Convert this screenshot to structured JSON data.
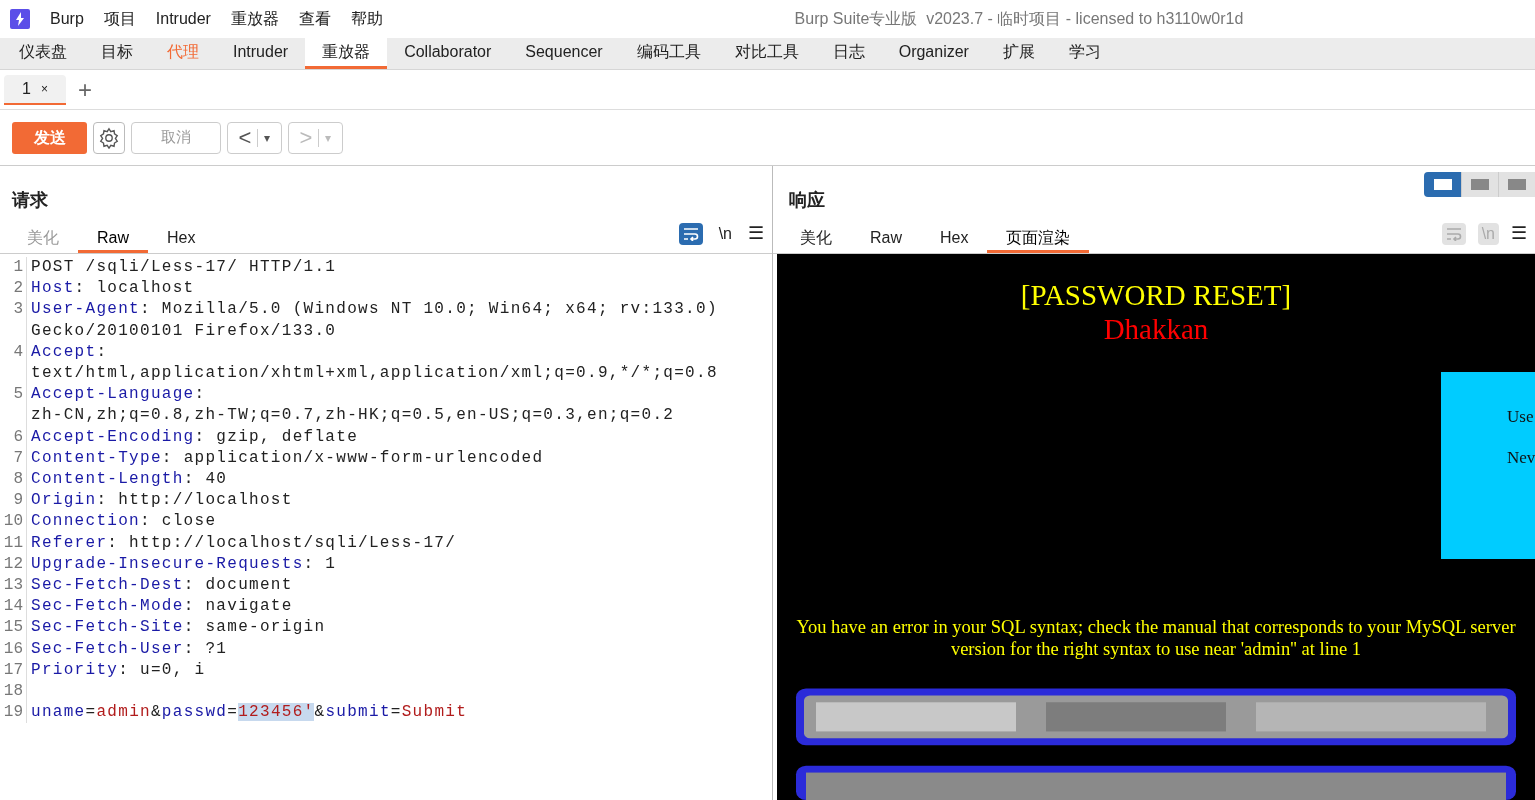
{
  "menu_bar": {
    "items": [
      "Burp",
      "项目",
      "Intruder",
      "重放器",
      "查看",
      "帮助"
    ],
    "title": "Burp Suite专业版  v2023.7 - 临时项目 - licensed to h3110w0r1d"
  },
  "main_tabs": [
    {
      "label": "仪表盘",
      "selected": false,
      "highlighted": false
    },
    {
      "label": "目标",
      "selected": false,
      "highlighted": false
    },
    {
      "label": "代理",
      "selected": false,
      "highlighted": true
    },
    {
      "label": "Intruder",
      "selected": false,
      "highlighted": false
    },
    {
      "label": "重放器",
      "selected": true,
      "highlighted": false
    },
    {
      "label": "Collaborator",
      "selected": false,
      "highlighted": false
    },
    {
      "label": "Sequencer",
      "selected": false,
      "highlighted": false
    },
    {
      "label": "编码工具",
      "selected": false,
      "highlighted": false
    },
    {
      "label": "对比工具",
      "selected": false,
      "highlighted": false
    },
    {
      "label": "日志",
      "selected": false,
      "highlighted": false
    },
    {
      "label": "Organizer",
      "selected": false,
      "highlighted": false
    },
    {
      "label": "扩展",
      "selected": false,
      "highlighted": false
    },
    {
      "label": "学习",
      "selected": false,
      "highlighted": false
    }
  ],
  "repeater_tabs": [
    {
      "label": "1",
      "close": "×",
      "selected": true
    }
  ],
  "new_tab": "+",
  "toolbar": {
    "send": "发送",
    "cancel": {
      "label": "取消",
      "disabled": true
    },
    "back": {
      "label": "<",
      "caret": "▾",
      "disabled": false
    },
    "forward": {
      "label": ">",
      "caret": "▾",
      "disabled": true
    }
  },
  "layout_toggle": [
    {
      "selected": true
    },
    {
      "selected": false
    },
    {
      "selected": false
    }
  ],
  "request": {
    "title": "请求",
    "tabs": [
      {
        "label": "美化",
        "selected": false,
        "disabled": true
      },
      {
        "label": "Raw",
        "selected": true,
        "disabled": false
      },
      {
        "label": "Hex",
        "selected": false,
        "disabled": false
      }
    ],
    "wrap_on": true,
    "newline_label": "\\n",
    "menu_icon": "☰",
    "lines": [
      {
        "number": "1",
        "rows": [
          [
            {
              "kind": "plain",
              "text": "POST /sqli/Less-17/ HTTP/1.1"
            }
          ]
        ]
      },
      {
        "number": "2",
        "rows": [
          [
            {
              "kind": "key",
              "text": "Host"
            },
            {
              "kind": "plain",
              "text": ": localhost"
            }
          ]
        ]
      },
      {
        "number": "3",
        "rows": [
          [
            {
              "kind": "key",
              "text": "User-Agent"
            },
            {
              "kind": "plain",
              "text": ": Mozilla/5.0 (Windows NT 10.0; Win64; x64; rv:133.0)"
            }
          ],
          [
            {
              "kind": "plain",
              "text": "Gecko/20100101 Firefox/133.0"
            }
          ]
        ]
      },
      {
        "number": "4",
        "rows": [
          [
            {
              "kind": "key",
              "text": "Accept"
            },
            {
              "kind": "plain",
              "text": ":"
            }
          ],
          [
            {
              "kind": "plain",
              "text": "text/html,application/xhtml+xml,application/xml;q=0.9,*/*;q=0.8"
            }
          ]
        ]
      },
      {
        "number": "5",
        "rows": [
          [
            {
              "kind": "key",
              "text": "Accept-Language"
            },
            {
              "kind": "plain",
              "text": ":"
            }
          ],
          [
            {
              "kind": "plain",
              "text": "zh-CN,zh;q=0.8,zh-TW;q=0.7,zh-HK;q=0.5,en-US;q=0.3,en;q=0.2"
            }
          ]
        ]
      },
      {
        "number": "6",
        "rows": [
          [
            {
              "kind": "key",
              "text": "Accept-Encoding"
            },
            {
              "kind": "plain",
              "text": ": gzip, deflate"
            }
          ]
        ]
      },
      {
        "number": "7",
        "rows": [
          [
            {
              "kind": "key",
              "text": "Content-Type"
            },
            {
              "kind": "plain",
              "text": ": application/x-www-form-urlencoded"
            }
          ]
        ]
      },
      {
        "number": "8",
        "rows": [
          [
            {
              "kind": "key",
              "text": "Content-Length"
            },
            {
              "kind": "plain",
              "text": ": 40"
            }
          ]
        ]
      },
      {
        "number": "9",
        "rows": [
          [
            {
              "kind": "key",
              "text": "Origin"
            },
            {
              "kind": "plain",
              "text": ": http://localhost"
            }
          ]
        ]
      },
      {
        "number": "10",
        "rows": [
          [
            {
              "kind": "key",
              "text": "Connection"
            },
            {
              "kind": "plain",
              "text": ": close"
            }
          ]
        ]
      },
      {
        "number": "11",
        "rows": [
          [
            {
              "kind": "key",
              "text": "Referer"
            },
            {
              "kind": "plain",
              "text": ": http://localhost/sqli/Less-17/"
            }
          ]
        ]
      },
      {
        "number": "12",
        "rows": [
          [
            {
              "kind": "key",
              "text": "Upgrade-Insecure-Requests"
            },
            {
              "kind": "plain",
              "text": ": 1"
            }
          ]
        ]
      },
      {
        "number": "13",
        "rows": [
          [
            {
              "kind": "key",
              "text": "Sec-Fetch-Dest"
            },
            {
              "kind": "plain",
              "text": ": document"
            }
          ]
        ]
      },
      {
        "number": "14",
        "rows": [
          [
            {
              "kind": "key",
              "text": "Sec-Fetch-Mode"
            },
            {
              "kind": "plain",
              "text": ": navigate"
            }
          ]
        ]
      },
      {
        "number": "15",
        "rows": [
          [
            {
              "kind": "key",
              "text": "Sec-Fetch-Site"
            },
            {
              "kind": "plain",
              "text": ": same-origin"
            }
          ]
        ]
      },
      {
        "number": "16",
        "rows": [
          [
            {
              "kind": "key",
              "text": "Sec-Fetch-User"
            },
            {
              "kind": "plain",
              "text": ": ?1"
            }
          ]
        ]
      },
      {
        "number": "17",
        "rows": [
          [
            {
              "kind": "key",
              "text": "Priority"
            },
            {
              "kind": "plain",
              "text": ": u=0, i"
            }
          ]
        ]
      },
      {
        "number": "18"
      },
      {
        "number": "19",
        "rows": [
          [
            {
              "kind": "key",
              "text": "uname"
            },
            {
              "kind": "plain",
              "text": "="
            },
            {
              "kind": "value",
              "text": "admin"
            },
            {
              "kind": "plain",
              "text": "&"
            },
            {
              "kind": "key",
              "text": "passwd"
            },
            {
              "kind": "plain",
              "text": "="
            },
            {
              "kind": "selected",
              "text": "123456'"
            },
            {
              "kind": "plain",
              "text": "&"
            },
            {
              "kind": "key",
              "text": "submit"
            },
            {
              "kind": "plain",
              "text": "="
            },
            {
              "kind": "value",
              "text": "Submit"
            }
          ]
        ]
      }
    ]
  },
  "response": {
    "title": "响应",
    "tabs": [
      {
        "label": "美化",
        "selected": false,
        "disabled": false
      },
      {
        "label": "Raw",
        "selected": false,
        "disabled": false
      },
      {
        "label": "Hex",
        "selected": false,
        "disabled": false
      },
      {
        "label": "页面渲染",
        "selected": true,
        "disabled": false
      }
    ],
    "wrap_on": false,
    "newline_label": "\\n",
    "menu_icon": "☰",
    "render": {
      "heading": "[PASSWORD RESET]",
      "subheading": "Dhakkan",
      "form_labels": [
        "Use",
        "Nev"
      ],
      "error": "You have an error in your SQL syntax; check the manual that corresponds to your MySQL server version for the right syntax to use near 'admin'' at line 1",
      "banner": {
        "kind": "picture"
      }
    }
  }
}
